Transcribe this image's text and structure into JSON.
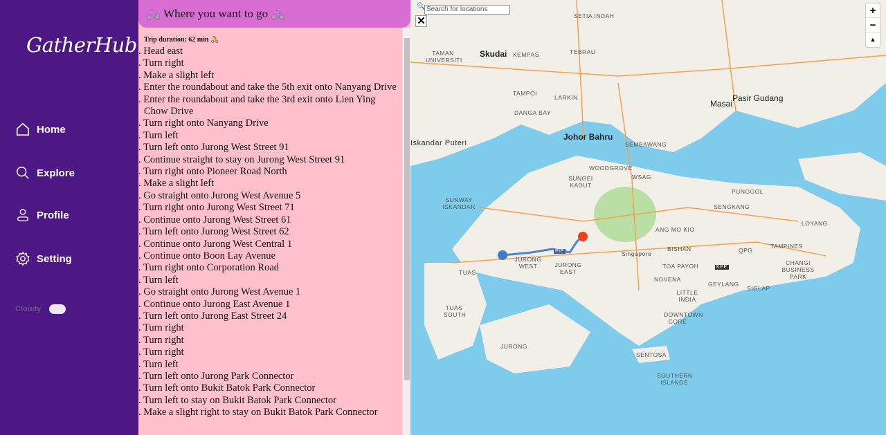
{
  "app": {
    "logo": "GatherHub"
  },
  "nav": [
    {
      "label": "Home",
      "icon": "home-icon"
    },
    {
      "label": "Explore",
      "icon": "search-icon"
    },
    {
      "label": "Profile",
      "icon": "user-icon"
    },
    {
      "label": "Setting",
      "icon": "gear-icon"
    }
  ],
  "weather": {
    "label": "Cloudy",
    "icon": "cloud-icon"
  },
  "panel": {
    "title": "🚲 Where you want to go 🚲",
    "duration": "Trip duration: 62 min 🚴",
    "steps": [
      ". Head east",
      ". Turn right",
      ". Make a slight left",
      ". Enter the roundabout and take the 5th exit onto Nanyang Drive",
      ". Enter the roundabout and take the 3rd exit onto Lien Ying Chow Drive",
      ". Turn right onto Nanyang Drive",
      ". Turn left",
      ". Turn left onto Jurong West Street 91",
      ". Continue straight to stay on Jurong West Street 91",
      ". Turn right onto Pioneer Road North",
      ". Make a slight left",
      ". Go straight onto Jurong West Avenue 5",
      ". Turn right onto Jurong West Street 71",
      ". Continue onto Jurong West Street 61",
      ". Turn left onto Jurong West Street 62",
      ". Continue onto Jurong West Central 1",
      ". Continue onto Boon Lay Avenue",
      ". Turn right onto Corporation Road",
      ". Turn left",
      ". Go straight onto Jurong West Avenue 1",
      ". Continue onto Jurong East Avenue 1",
      ". Turn left onto Jurong East Street 24",
      ". Turn right",
      ". Turn right",
      ". Turn right",
      ". Turn left",
      ". Turn left onto Jurong Park Connector",
      ". Turn left onto Bukit Batok Park Connector",
      ". Turn left to stay on Bukit Batok Park Connector",
      ". Make a slight right to stay on Bukit Batok Park Connector"
    ]
  },
  "map": {
    "search_placeholder": "Search for locations",
    "close": "✕",
    "zoom_in": "+",
    "zoom_out": "−",
    "compass": "▲",
    "labels": [
      {
        "t": "Skudai"
      },
      {
        "t": "Johor Bahru"
      },
      {
        "t": "Masai"
      },
      {
        "t": "Pasir Gudang"
      },
      {
        "t": "Singapore"
      },
      {
        "t": "TAMAN UNIVERSITI"
      },
      {
        "t": "KEMPAS"
      },
      {
        "t": "TEBRAU"
      },
      {
        "t": "TAMPOI"
      },
      {
        "t": "LARKIN"
      },
      {
        "t": "SEMBAWANG"
      },
      {
        "t": "WOODGROVE"
      },
      {
        "t": "WSAG"
      },
      {
        "t": "SUNGEI KADUT"
      },
      {
        "t": "SUNWAY ISKANDAR"
      },
      {
        "t": "JURONG WEST"
      },
      {
        "t": "JURONG EAST"
      },
      {
        "t": "TUAS"
      },
      {
        "t": "BISHAN"
      },
      {
        "t": "TOA PAYOH"
      },
      {
        "t": "NOVENA"
      },
      {
        "t": "GEYLANG"
      },
      {
        "t": "TAMPINES"
      },
      {
        "t": "CHANGI BUSINESS PARK"
      },
      {
        "t": "SIGLAP"
      },
      {
        "t": "PUNGGOL"
      },
      {
        "t": "SENGKANG"
      },
      {
        "t": "ANG MO KIO"
      },
      {
        "t": "LOYANG"
      },
      {
        "t": "DOWNTOWN CORE"
      },
      {
        "t": "LITTLE INDIA"
      },
      {
        "t": "SENTOSA"
      },
      {
        "t": "SOUTHERN ISLANDS"
      },
      {
        "t": "JURONG"
      },
      {
        "t": "TUAS SOUTH"
      },
      {
        "t": "QPG"
      },
      {
        "t": "Iskandar Puteri"
      },
      {
        "t": "DANGA BAY"
      },
      {
        "t": "SETIA INDAH"
      },
      {
        "t": "PIE"
      },
      {
        "t": "KPE"
      }
    ]
  },
  "colors": {
    "sidebar": "#4e1786",
    "header": "#da6dd4",
    "panel": "#ffc0cb",
    "water": "#7ecbec",
    "land": "#f2efe9",
    "route": "#4a86c8",
    "start": "#3b7fc4",
    "end": "#f0401e"
  }
}
